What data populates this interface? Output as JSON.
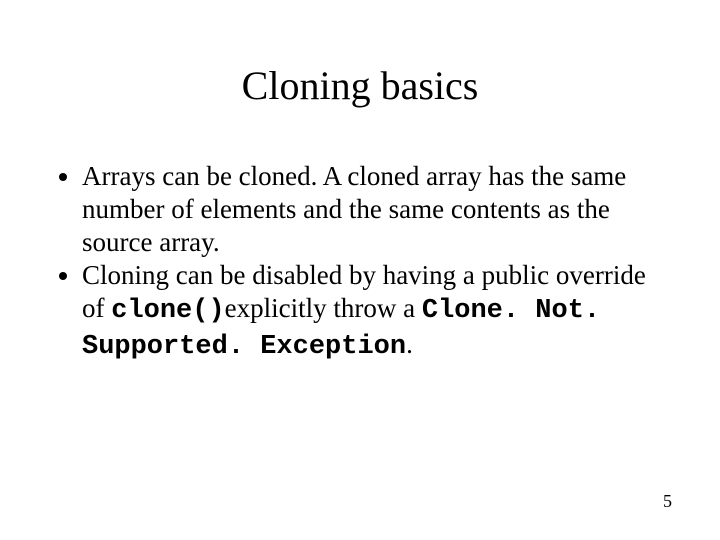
{
  "title": "Cloning basics",
  "bullets": [
    {
      "pre": "Arrays can be cloned. A cloned array has the same number of elements and the same contents as the source array."
    },
    {
      "pre": "Cloning can be disabled by having a public override of ",
      "code1": "clone()",
      "mid": "explicitly throw a ",
      "code2": "Clone. Not. Supported. Exception",
      "post": "."
    }
  ],
  "page_number": "5"
}
